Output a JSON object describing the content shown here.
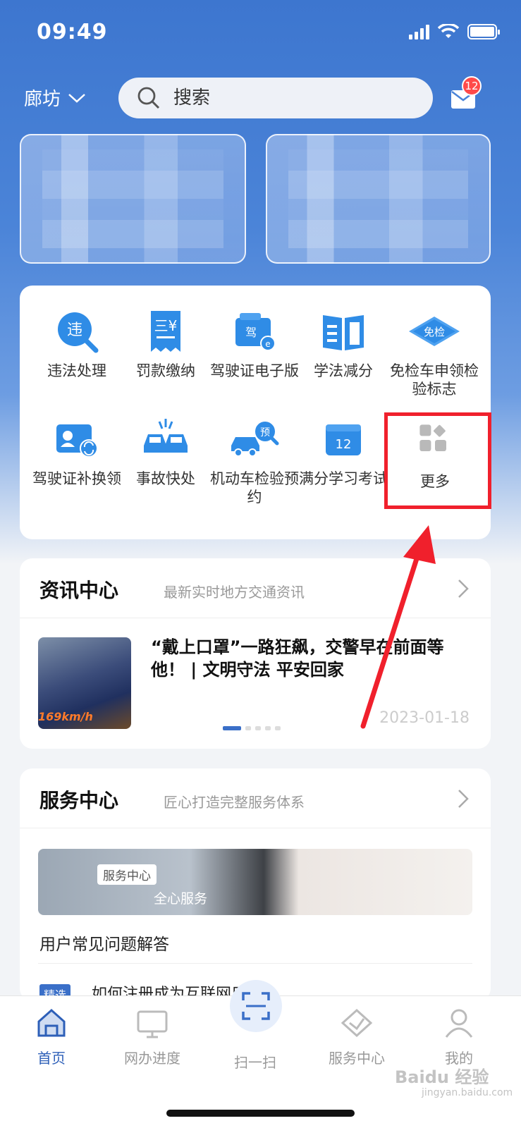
{
  "status_bar": {
    "time": "09:49"
  },
  "header": {
    "city": "廊坊",
    "search_placeholder": "搜索",
    "mail_badge": "12"
  },
  "functions": [
    {
      "label": "违法处理",
      "icon": "violation-search-icon"
    },
    {
      "label": "罚款缴纳",
      "icon": "fine-receipt-icon"
    },
    {
      "label": "驾驶证电子版",
      "icon": "electronic-license-icon"
    },
    {
      "label": "学法减分",
      "icon": "study-book-icon"
    },
    {
      "label": "免检车申领检验标志",
      "icon": "exempt-inspection-icon",
      "badge_text": "免检"
    },
    {
      "label": "驾驶证补换领",
      "icon": "license-reissue-icon"
    },
    {
      "label": "事故快处",
      "icon": "accident-cars-icon"
    },
    {
      "label": "机动车检验预约",
      "icon": "vehicle-inspection-booking-icon",
      "badge_text": "预"
    },
    {
      "label": "满分学习考试",
      "icon": "full-score-exam-icon",
      "badge_text": "12"
    },
    {
      "label": "更多",
      "icon": "more-grid-icon"
    }
  ],
  "news": {
    "title": "资讯中心",
    "subtitle": "最新实时地方交通资讯",
    "headline": "“戴上口罩”一路狂飙，交警早在前面等他！ | 文明守法 平安回家",
    "date": "2023-01-18",
    "thumb_text": "169km/h"
  },
  "service": {
    "title": "服务中心",
    "subtitle": "匠心打造完整服务体系",
    "banner_tag": "服务中心",
    "banner_text": "全心服务",
    "faq_title": "用户常见问题解答",
    "faq_tag": "精选",
    "faq_question": "如何注册成为互联网用户?"
  },
  "tabbar": [
    {
      "label": "首页",
      "icon": "home-icon",
      "active": true
    },
    {
      "label": "网办进度",
      "icon": "monitor-icon",
      "active": false
    },
    {
      "label": "扫一扫",
      "icon": "scan-icon",
      "active": false
    },
    {
      "label": "服务中心",
      "icon": "service-diamond-icon",
      "active": false
    },
    {
      "label": "我的",
      "icon": "user-icon",
      "active": false
    }
  ],
  "watermark": {
    "text": "Baidu 经验",
    "sub": "jingyan.baidu.com"
  },
  "colors": {
    "primary": "#3d76cf",
    "annotation": "#f0202c"
  }
}
